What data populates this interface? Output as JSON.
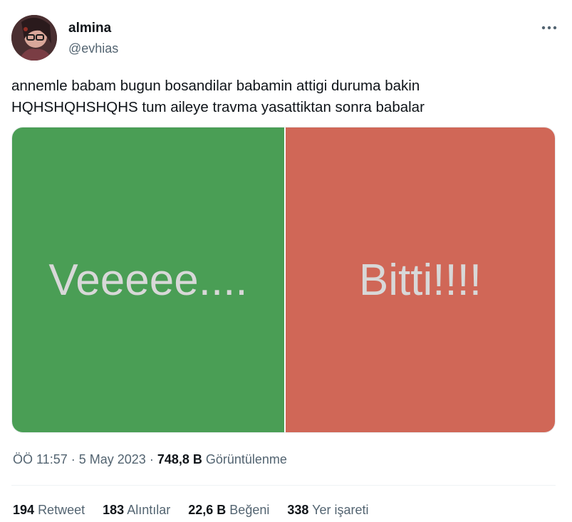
{
  "user": {
    "name": "almina",
    "handle": "@evhias"
  },
  "tweet": {
    "line1": "annemle babam bugun bosandilar babamin attigi duruma bakin",
    "line2": "HQHSHQHSHQHS tum aileye travma yasattiktan sonra babalar"
  },
  "media": {
    "left_text": "Veeeee....",
    "right_text": "Bitti!!!!",
    "left_color": "#4a9e55",
    "right_color": "#d06757"
  },
  "meta": {
    "time": "ÖÖ 11:57",
    "date": "5 May 2023",
    "views_count": "748,8 B",
    "views_label": "Görüntülenme"
  },
  "stats": {
    "retweets_count": "194",
    "retweets_label": "Retweet",
    "quotes_count": "183",
    "quotes_label": "Alıntılar",
    "likes_count": "22,6 B",
    "likes_label": "Beğeni",
    "bookmarks_count": "338",
    "bookmarks_label": "Yer işareti"
  },
  "icons": {
    "more": "more-horizontal-icon"
  }
}
